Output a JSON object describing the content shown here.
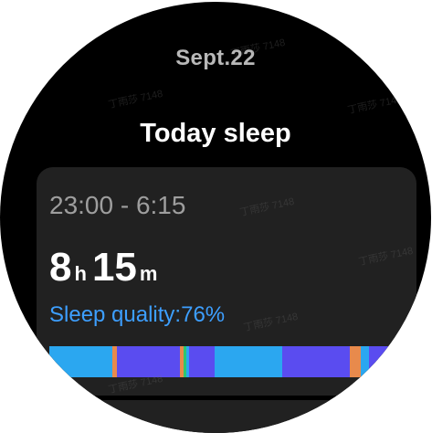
{
  "header": {
    "date": "Sept.22",
    "title": "Today sleep"
  },
  "sleep": {
    "time_range": "23:00 - 6:15",
    "hours": "8",
    "hours_unit": "h",
    "minutes": "15",
    "minutes_unit": "m",
    "quality_label": "Sleep quality:76%"
  },
  "stage_colors": {
    "light": "#2ba7f0",
    "deep": "#5a4cf0",
    "awake": "#e88a4c",
    "rem": "#2cc870"
  },
  "stages": [
    {
      "stage": "light",
      "fraction": 0.172
    },
    {
      "stage": "awake",
      "fraction": 0.012
    },
    {
      "stage": "deep",
      "fraction": 0.172
    },
    {
      "stage": "awake",
      "fraction": 0.01
    },
    {
      "stage": "rem",
      "fraction": 0.006
    },
    {
      "stage": "light",
      "fraction": 0.008
    },
    {
      "stage": "deep",
      "fraction": 0.07
    },
    {
      "stage": "light",
      "fraction": 0.184
    },
    {
      "stage": "deep",
      "fraction": 0.184
    },
    {
      "stage": "awake",
      "fraction": 0.03
    },
    {
      "stage": "light",
      "fraction": 0.022
    },
    {
      "stage": "deep",
      "fraction": 0.08
    },
    {
      "stage": "rem",
      "fraction": 0.05
    }
  ],
  "watermark_text": "丁雨莎 7148"
}
